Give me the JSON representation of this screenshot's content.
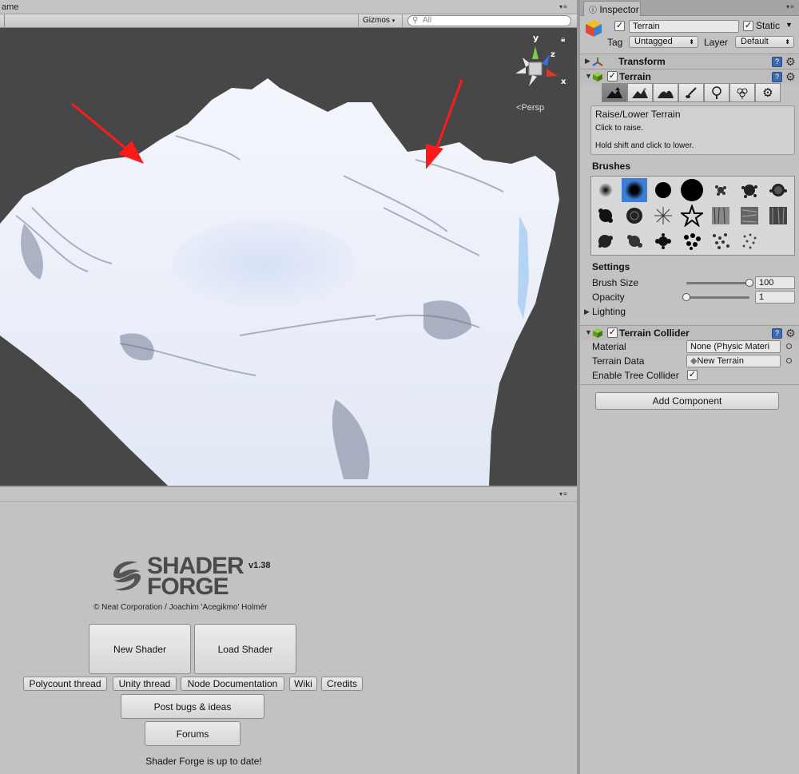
{
  "scene": {
    "tab_label": "ame",
    "gizmos_label": "Gizmos",
    "search_placeholder": "All",
    "persp_label": "Persp",
    "axis_labels": {
      "y": "y",
      "z": "z",
      "x": "x"
    },
    "annotation_color": "#ff1a1a"
  },
  "shader_forge": {
    "logo_line1": "SHADER",
    "logo_line2": "FORGE",
    "version": "v1.38",
    "credit": "© Neat Corporation / Joachim 'Acegikmo' Holmér",
    "new_shader": "New Shader",
    "load_shader": "Load Shader",
    "links": [
      "Polycount thread",
      "Unity thread",
      "Node Documentation",
      "Wiki",
      "Credits"
    ],
    "post_bugs": "Post bugs & ideas",
    "forums": "Forums",
    "status": "Shader Forge is up to date!"
  },
  "inspector": {
    "tab_label": "Inspector",
    "object_name": "Terrain",
    "static_label": "Static",
    "tag_label": "Tag",
    "tag_value": "Untagged",
    "layer_label": "Layer",
    "layer_value": "Default",
    "transform_title": "Transform",
    "terrain_title": "Terrain",
    "tools": [
      "raise-lower",
      "paint-height",
      "smooth-height",
      "paint-texture",
      "place-trees",
      "paint-details",
      "settings"
    ],
    "help_title": "Raise/Lower Terrain",
    "help_line1": "Click to raise.",
    "help_line2": "Hold shift and click to lower.",
    "brushes_label": "Brushes",
    "settings_label": "Settings",
    "brush_size_label": "Brush Size",
    "brush_size_value": "100",
    "brush_size_fraction": 1.0,
    "opacity_label": "Opacity",
    "opacity_value": "1",
    "opacity_fraction": 0.0,
    "lighting_label": "Lighting",
    "collider_title": "Terrain Collider",
    "material_label": "Material",
    "material_value": "None (Physic Materi",
    "terrain_data_label": "Terrain Data",
    "terrain_data_value": "New Terrain",
    "enable_tree_label": "Enable Tree Collider",
    "add_component": "Add Component",
    "accent_color": "#3d7ed6"
  }
}
